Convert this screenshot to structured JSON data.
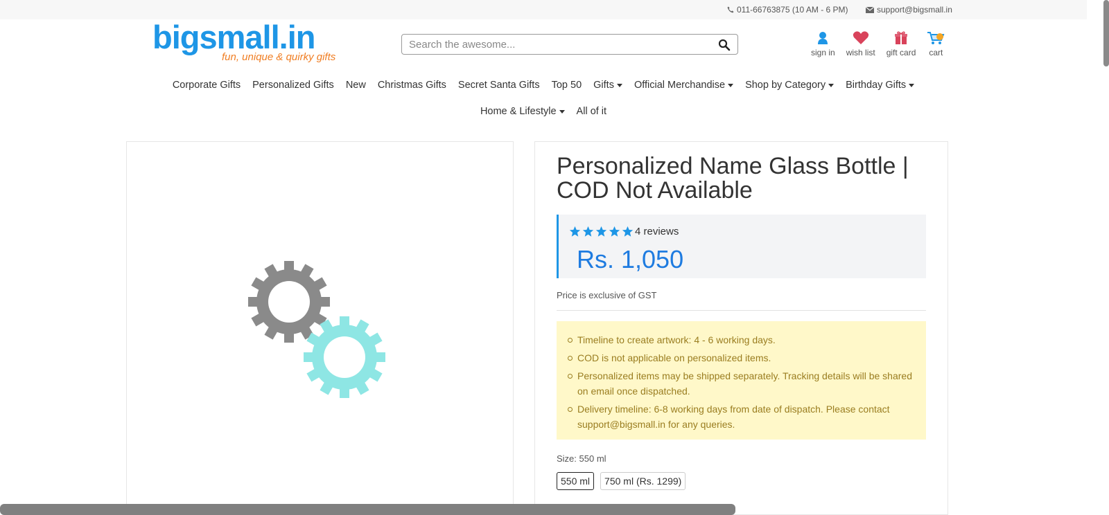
{
  "topbar": {
    "phone": "011-66763875 (10 AM - 6 PM)",
    "email": "support@bigsmall.in"
  },
  "logo": {
    "wordmark": "bigsmall.in",
    "tagline": "fun, unique & quirky gifts"
  },
  "search": {
    "placeholder": "Search the awesome...",
    "value": "",
    "icon": "search-icon"
  },
  "header_icons": [
    {
      "label": "sign in",
      "icon": "user-icon"
    },
    {
      "label": "wish list",
      "icon": "heart-icon"
    },
    {
      "label": "gift card",
      "icon": "gift-icon"
    },
    {
      "label": "cart",
      "icon": "cart-icon"
    }
  ],
  "nav": {
    "row1": [
      {
        "label": "Corporate Gifts",
        "dropdown": false
      },
      {
        "label": "Personalized Gifts",
        "dropdown": false
      },
      {
        "label": "New",
        "dropdown": false
      },
      {
        "label": "Christmas Gifts",
        "dropdown": false
      },
      {
        "label": "Secret Santa Gifts",
        "dropdown": false
      },
      {
        "label": "Top 50",
        "dropdown": false
      },
      {
        "label": "Gifts",
        "dropdown": true
      },
      {
        "label": "Official Merchandise",
        "dropdown": true
      },
      {
        "label": "Shop by Category",
        "dropdown": true
      },
      {
        "label": "Birthday Gifts",
        "dropdown": true
      }
    ],
    "row2": [
      {
        "label": "Home & Lifestyle",
        "dropdown": true
      },
      {
        "label": "All of it",
        "dropdown": false
      }
    ]
  },
  "product": {
    "title": "Personalized Name Glass Bottle | COD Not Available",
    "rating": 5,
    "reviews": "4 reviews",
    "price": "Rs. 1,050",
    "gst_note": "Price is exclusive of GST",
    "notes": [
      "Timeline to create artwork: 4 - 6 working days.",
      "COD is not applicable on personalized items.",
      "Personalized items may be shipped separately. Tracking details will be shared on email once dispatched.",
      "Delivery timeline: 6-8 working days from date of dispatch. Please contact support@bigsmall.in for any queries."
    ],
    "size_label": "Size: 550 ml",
    "sizes": [
      "550 ml",
      "750 ml (Rs. 1299)"
    ],
    "selected_size": "550 ml"
  },
  "colors": {
    "brand_blue": "#1e96e6",
    "brand_orange": "#f07d22",
    "price_blue": "#1e7be0",
    "notice_bg": "#fff8c9",
    "notice_text": "#9a7d20",
    "gear_gray": "#8a8a8a",
    "gear_teal": "#8ee6e4"
  }
}
